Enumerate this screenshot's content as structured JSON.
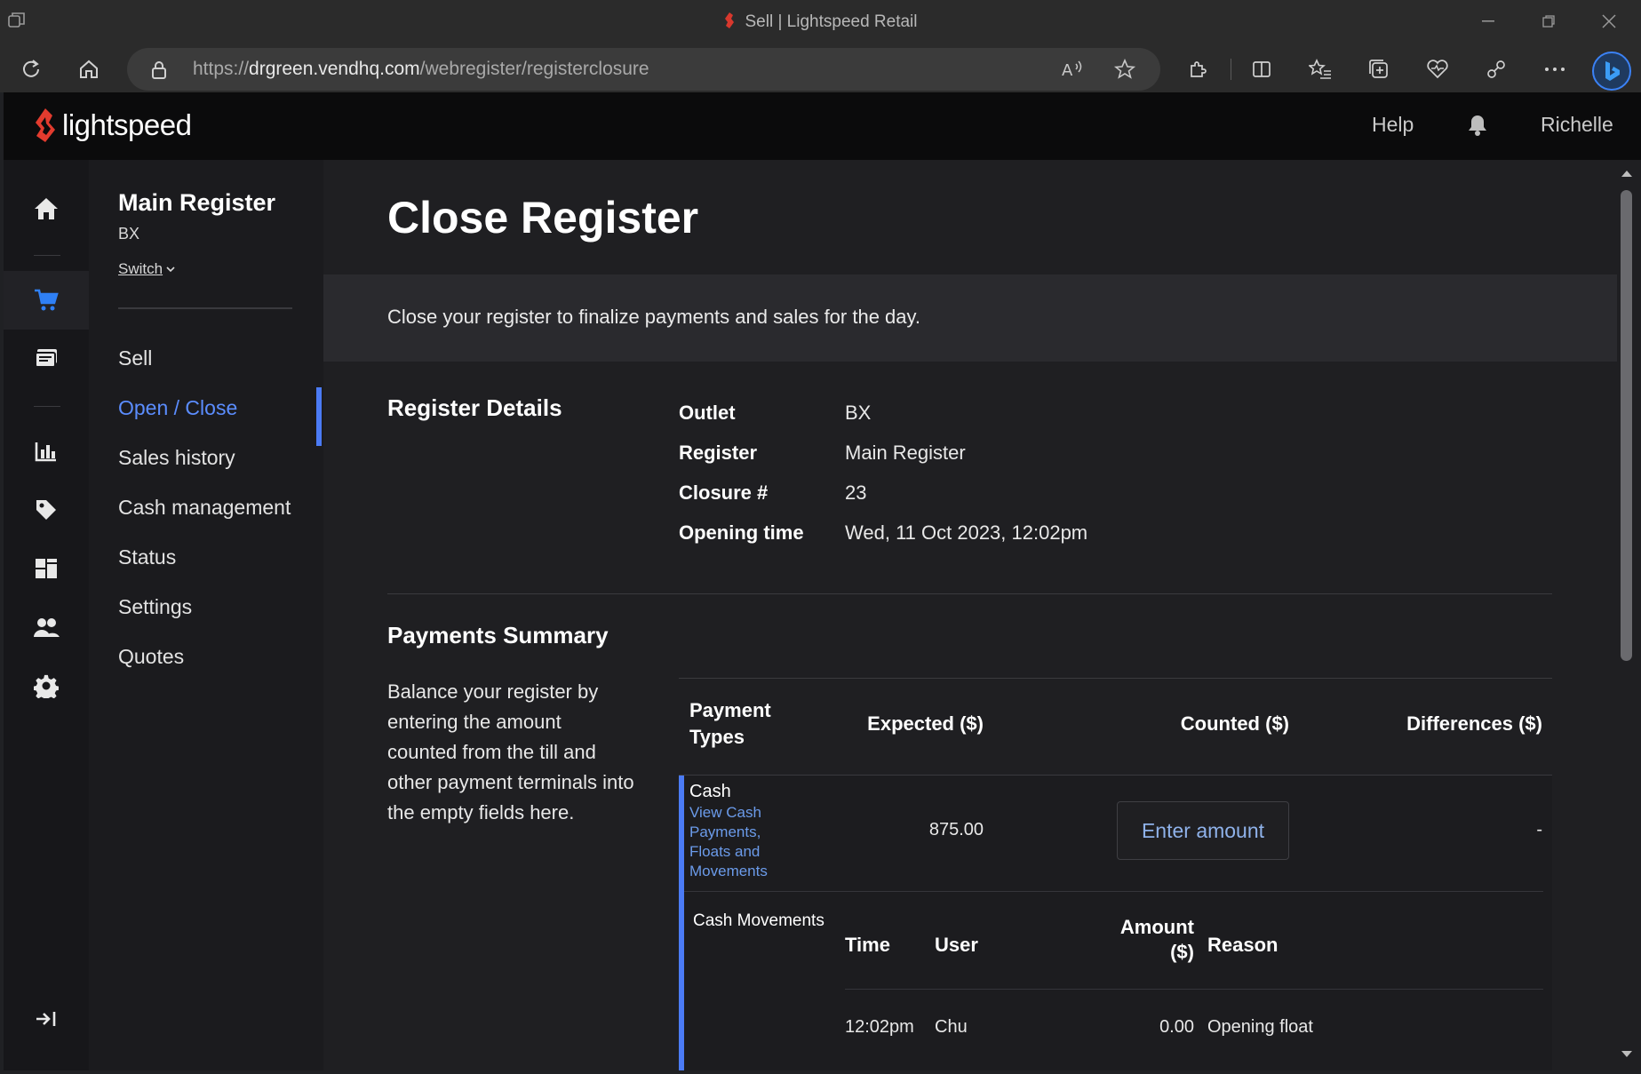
{
  "browser": {
    "window_title": "Sell | Lightspeed Retail",
    "url_prefix": "https://",
    "url_host": "drgreen.vendhq.com",
    "url_path": "/webregister/registerclosure"
  },
  "app": {
    "logo_text": "lightspeed",
    "help_label": "Help",
    "user_name": "Richelle",
    "accent_color": "#4b7bf5"
  },
  "rail": {
    "icons": [
      "home-icon",
      "cart-icon",
      "register-icon",
      "reports-icon",
      "tag-icon",
      "catalog-icon",
      "customers-icon",
      "settings-icon",
      "expand-icon"
    ]
  },
  "register": {
    "name": "Main Register",
    "outlet": "BX",
    "switch_label": "Switch"
  },
  "subnav": {
    "items": [
      {
        "label": "Sell"
      },
      {
        "label": "Open / Close"
      },
      {
        "label": "Sales history"
      },
      {
        "label": "Cash management"
      },
      {
        "label": "Status"
      },
      {
        "label": "Settings"
      },
      {
        "label": "Quotes"
      }
    ]
  },
  "page": {
    "title": "Close Register",
    "banner": "Close your register to finalize payments and sales for the day."
  },
  "details": {
    "title": "Register Details",
    "rows": [
      {
        "label": "Outlet",
        "value": "BX"
      },
      {
        "label": "Register",
        "value": "Main Register"
      },
      {
        "label": "Closure #",
        "value": "23"
      },
      {
        "label": "Opening time",
        "value": "Wed, 11 Oct 2023, 12:02pm"
      }
    ]
  },
  "payments": {
    "title": "Payments Summary",
    "description": "Balance your register by entering the amount counted from the till and other payment terminals into the empty fields here.",
    "columns": {
      "payment_types_1": "Payment",
      "payment_types_2": "Types",
      "expected": "Expected ($)",
      "counted": "Counted ($)",
      "differences": "Differences ($)"
    },
    "cash": {
      "name": "Cash",
      "link": "View Cash Payments, Floats and Movements",
      "expected": "875.00",
      "counted_placeholder": "Enter amount",
      "difference": "-"
    },
    "cash_movements": {
      "label": "Cash Movements",
      "columns": {
        "time": "Time",
        "user": "User",
        "amount_1": "Amount",
        "amount_2": "($)",
        "reason": "Reason"
      },
      "rows": [
        {
          "time": "12:02pm",
          "user": "Chu",
          "amount": "0.00",
          "reason": "Opening float"
        }
      ]
    }
  }
}
